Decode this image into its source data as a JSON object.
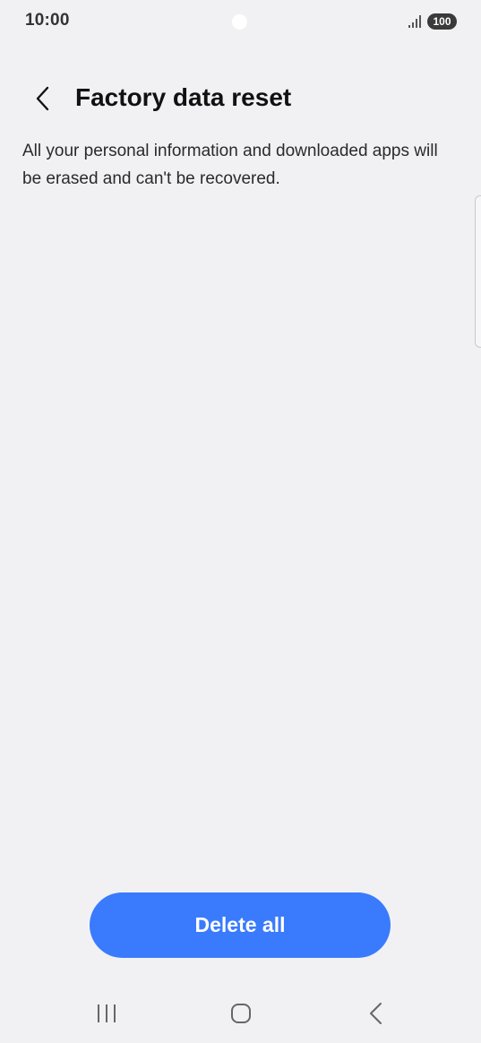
{
  "status_bar": {
    "time": "10:00",
    "battery": "100",
    "signal_icon": "signal-bars-icon"
  },
  "header": {
    "back_icon": "chevron-left-icon",
    "title": "Factory data reset"
  },
  "content": {
    "description": "All your personal information and downloaded apps will be erased and can't be recovered."
  },
  "actions": {
    "delete_all_label": "Delete all"
  },
  "nav_bar": {
    "recents_icon": "recents-icon",
    "home_icon": "home-icon",
    "back_icon": "back-icon"
  },
  "colors": {
    "background": "#f1f1f4",
    "primary_button": "#3a7bfd",
    "battery_badge": "#3a3a3a"
  }
}
